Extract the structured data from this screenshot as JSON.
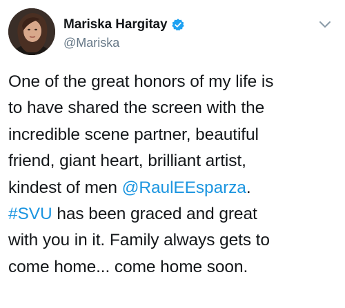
{
  "tweet": {
    "author": {
      "display_name": "Mariska Hargitay",
      "handle": "@Mariska",
      "verified": true,
      "avatar_icon": "profile-photo",
      "verified_icon": "verified-badge-icon"
    },
    "menu_icon": "chevron-down-icon",
    "text_lines": [
      [
        {
          "text": "One of the great honors of my life is",
          "type": "text"
        }
      ],
      [
        {
          "text": "to have shared the screen with the",
          "type": "text"
        }
      ],
      [
        {
          "text": "incredible scene partner, beautiful",
          "type": "text"
        }
      ],
      [
        {
          "text": "friend, giant heart, brilliant artist,",
          "type": "text"
        }
      ],
      [
        {
          "text": "kindest of men ",
          "type": "text"
        },
        {
          "text": "@RaulEEsparza",
          "type": "mention"
        },
        {
          "text": ".",
          "type": "text"
        }
      ],
      [
        {
          "text": "#SVU",
          "type": "hashtag"
        },
        {
          "text": " has been graced and great",
          "type": "text"
        }
      ],
      [
        {
          "text": "with you in it. Family always gets to",
          "type": "text"
        }
      ],
      [
        {
          "text": "come home... come home soon.",
          "type": "text"
        }
      ]
    ]
  },
  "colors": {
    "text": "#14171a",
    "secondary": "#657786",
    "link": "#1b95e0",
    "verified": "#1da1f2",
    "background": "#ffffff"
  }
}
